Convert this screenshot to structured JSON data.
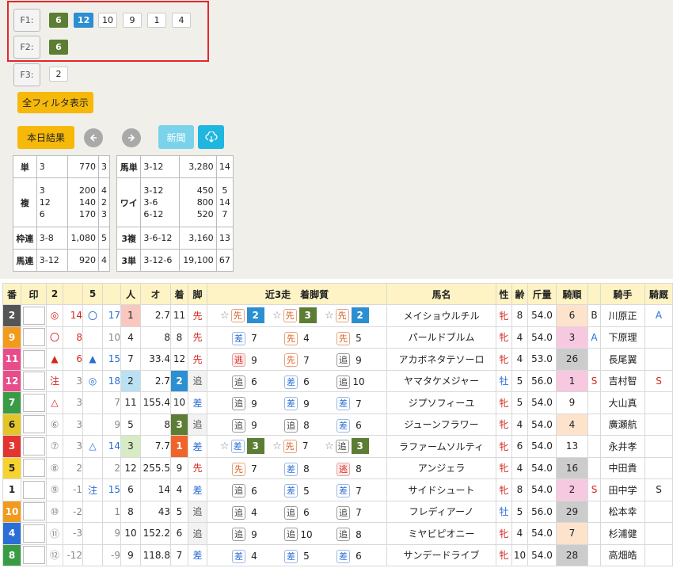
{
  "filters": {
    "f1": {
      "label": "F1:",
      "values": [
        "6",
        "12",
        "10",
        "9",
        "1",
        "4"
      ]
    },
    "f2": {
      "label": "F2:",
      "values": [
        "6"
      ]
    },
    "f3": {
      "label": "F3:",
      "values": [
        "2"
      ]
    },
    "show_all": "全フィルタ表示"
  },
  "controls": {
    "today_results": "本日結果",
    "prev_icon": "arrow-left-icon",
    "next_icon": "arrow-right-icon",
    "news": "新聞",
    "download_icon": "cloud-download-icon"
  },
  "payouts_left": [
    {
      "type": "単",
      "lines": [
        [
          "3",
          "770",
          "3"
        ]
      ]
    },
    {
      "type": "複",
      "lines": [
        [
          "3",
          "200",
          "4"
        ],
        [
          "12",
          "140",
          "2"
        ],
        [
          "6",
          "170",
          "3"
        ]
      ]
    },
    {
      "type": "枠連",
      "lines": [
        [
          "3-8",
          "1,080",
          "5"
        ]
      ]
    },
    {
      "type": "馬連",
      "lines": [
        [
          "3-12",
          "920",
          "4"
        ]
      ]
    }
  ],
  "payouts_right": [
    {
      "type": "馬単",
      "lines": [
        [
          "3-12",
          "3,280",
          "14"
        ]
      ]
    },
    {
      "type": "ワイ",
      "lines": [
        [
          "3-12",
          "450",
          "5"
        ],
        [
          "3-6",
          "800",
          "14"
        ],
        [
          "6-12",
          "520",
          "7"
        ]
      ]
    },
    {
      "type": "3複",
      "lines": [
        [
          "3-6-12",
          "3,160",
          "13"
        ]
      ]
    },
    {
      "type": "3単",
      "lines": [
        [
          "3-12-6",
          "19,100",
          "67"
        ]
      ]
    }
  ],
  "headers": [
    "番",
    "印",
    "2",
    "",
    "5",
    "",
    "人",
    "オ",
    "着",
    "脚",
    "近3走　着脚質",
    "馬名",
    "性",
    "齢",
    "斤量",
    "騎順",
    "",
    "騎手",
    "騎厩"
  ],
  "rows": [
    {
      "num": "2",
      "nc": "#555",
      "m1": "◎",
      "c1": "14",
      "m2": "〇",
      "c2": "17",
      "pop": "1",
      "popbg": "#f8c7bd",
      "odds": "2.7",
      "fin": "11",
      "finbg": "",
      "kyaku": "先",
      "kc": "red",
      "recent": [
        [
          "先",
          "2"
        ],
        [
          "先",
          "3"
        ],
        [
          "先",
          "2"
        ]
      ],
      "recentStar": [
        true,
        true,
        true
      ],
      "name": "メイショウルチル",
      "sex": "牝",
      "sexc": "red",
      "age": "8",
      "wt": "54.0",
      "jr": "6",
      "jrbg": "#fde3cc",
      "jb": "B",
      "jockey": "川原正",
      "jk": "A",
      "jkc": "blu"
    },
    {
      "num": "9",
      "nc": "#f29a1b",
      "m1": "〇",
      "c1": "8",
      "m2": "",
      "c2": "10",
      "pop": "4",
      "popbg": "",
      "odds": "8",
      "fin": "8",
      "finbg": "",
      "kyaku": "先",
      "kc": "red",
      "recent": [
        [
          "差",
          "7"
        ],
        [
          "先",
          "4"
        ],
        [
          "先",
          "5"
        ]
      ],
      "recentStar": [
        false,
        false,
        false
      ],
      "name": "パールドブルム",
      "sex": "牝",
      "sexc": "red",
      "age": "4",
      "wt": "54.0",
      "jr": "3",
      "jrbg": "#f7c9e0",
      "jb": "A",
      "jockey": "下原理",
      "jk": "",
      "jkc": ""
    },
    {
      "num": "11",
      "nc": "#e84d8a",
      "m1": "▲",
      "c1": "6",
      "m2": "▲",
      "c2": "15",
      "pop": "7",
      "popbg": "",
      "odds": "33.4",
      "fin": "12",
      "finbg": "",
      "kyaku": "先",
      "kc": "red",
      "recent": [
        [
          "逃",
          "9"
        ],
        [
          "先",
          "7"
        ],
        [
          "追",
          "9"
        ]
      ],
      "recentStar": [
        false,
        false,
        false
      ],
      "name": "アカボネタテソーロ",
      "sex": "牝",
      "sexc": "red",
      "age": "4",
      "wt": "53.0",
      "jr": "26",
      "jrbg": "#ccc",
      "jb": "",
      "jockey": "長尾翼",
      "jk": "",
      "jkc": ""
    },
    {
      "num": "12",
      "nc": "#e84d8a",
      "m1": "注",
      "c1": "3",
      "m2": "◎",
      "c2": "18",
      "pop": "2",
      "popbg": "#b9e1f3",
      "odds": "2.7",
      "fin": "2",
      "finbg": "#2b8fd1",
      "kyaku": "追",
      "kc": "gry",
      "recent": [
        [
          "追",
          "6"
        ],
        [
          "差",
          "6"
        ],
        [
          "追",
          "10"
        ]
      ],
      "recentStar": [
        false,
        false,
        false
      ],
      "name": "ヤマタケメジャー",
      "sex": "牡",
      "sexc": "blu",
      "age": "5",
      "wt": "56.0",
      "jr": "1",
      "jrbg": "#f7c9e0",
      "jb": "S",
      "jockey": "吉村智",
      "jk": "S",
      "jkc": "red"
    },
    {
      "num": "7",
      "nc": "#3a9b45",
      "m1": "△",
      "c1": "3",
      "m2": "",
      "c2": "7",
      "pop": "11",
      "popbg": "",
      "odds": "155.4",
      "fin": "10",
      "finbg": "",
      "kyaku": "差",
      "kc": "blu",
      "recent": [
        [
          "追",
          "9"
        ],
        [
          "差",
          "9"
        ],
        [
          "差",
          "7"
        ]
      ],
      "recentStar": [
        false,
        false,
        false
      ],
      "name": "ジプソフィーユ",
      "sex": "牝",
      "sexc": "red",
      "age": "5",
      "wt": "54.0",
      "jr": "9",
      "jrbg": "",
      "jb": "",
      "jockey": "大山真",
      "jk": "",
      "jkc": ""
    },
    {
      "num": "6",
      "nc": "#e3c52a",
      "m1": "⑥",
      "c1": "3",
      "m2": "",
      "c2": "9",
      "pop": "5",
      "popbg": "",
      "odds": "8",
      "fin": "3",
      "finbg": "#5b7d34",
      "kyaku": "追",
      "kc": "gry",
      "recent": [
        [
          "追",
          "9"
        ],
        [
          "追",
          "8"
        ],
        [
          "差",
          "6"
        ]
      ],
      "recentStar": [
        false,
        false,
        false
      ],
      "name": "ジューンフラワー",
      "sex": "牝",
      "sexc": "red",
      "age": "4",
      "wt": "54.0",
      "jr": "4",
      "jrbg": "#fde3cc",
      "jb": "",
      "jockey": "廣瀬航",
      "jk": "",
      "jkc": ""
    },
    {
      "num": "3",
      "nc": "#e3342f",
      "m1": "⑦",
      "c1": "3",
      "m2": "△",
      "c2": "14",
      "pop": "3",
      "popbg": "#d7ebc5",
      "odds": "7.7",
      "fin": "1",
      "finbg": "#f0642b",
      "kyaku": "差",
      "kc": "blu",
      "recent": [
        [
          "差",
          "3"
        ],
        [
          "先",
          "7"
        ],
        [
          "追",
          "3"
        ]
      ],
      "recentStar": [
        true,
        true,
        true
      ],
      "name": "ラファームソルティ",
      "sex": "牝",
      "sexc": "red",
      "age": "6",
      "wt": "54.0",
      "jr": "13",
      "jrbg": "",
      "jb": "",
      "jockey": "永井孝",
      "jk": "",
      "jkc": ""
    },
    {
      "num": "5",
      "nc": "#f6d32f",
      "m1": "⑧",
      "c1": "2",
      "m2": "",
      "c2": "2",
      "pop": "12",
      "popbg": "",
      "odds": "255.5",
      "fin": "9",
      "finbg": "",
      "kyaku": "先",
      "kc": "red",
      "recent": [
        [
          "先",
          "7"
        ],
        [
          "差",
          "8"
        ],
        [
          "逃",
          "8"
        ]
      ],
      "recentStar": [
        false,
        false,
        false
      ],
      "name": "アンジェラ",
      "sex": "牝",
      "sexc": "red",
      "age": "4",
      "wt": "54.0",
      "jr": "16",
      "jrbg": "#ccc",
      "jb": "",
      "jockey": "中田貴",
      "jk": "",
      "jkc": ""
    },
    {
      "num": "1",
      "nc": "#fff",
      "m1": "⑨",
      "c1": "-1",
      "m2": "注",
      "c2": "15",
      "pop": "6",
      "popbg": "",
      "odds": "14",
      "fin": "4",
      "finbg": "",
      "kyaku": "差",
      "kc": "blu",
      "recent": [
        [
          "追",
          "6"
        ],
        [
          "差",
          "5"
        ],
        [
          "差",
          "7"
        ]
      ],
      "recentStar": [
        false,
        false,
        false
      ],
      "name": "サイドシュート",
      "sex": "牝",
      "sexc": "red",
      "age": "8",
      "wt": "54.0",
      "jr": "2",
      "jrbg": "#f7c9e0",
      "jb": "S",
      "jockey": "田中学",
      "jk": "S",
      "jkc": ""
    },
    {
      "num": "10",
      "nc": "#f29a1b",
      "m1": "⑩",
      "c1": "-2",
      "m2": "",
      "c2": "1",
      "pop": "8",
      "popbg": "",
      "odds": "43",
      "fin": "5",
      "finbg": "",
      "kyaku": "追",
      "kc": "gry",
      "recent": [
        [
          "追",
          "4"
        ],
        [
          "追",
          "6"
        ],
        [
          "追",
          "7"
        ]
      ],
      "recentStar": [
        false,
        false,
        false
      ],
      "name": "フレディアーノ",
      "sex": "牡",
      "sexc": "blu",
      "age": "5",
      "wt": "56.0",
      "jr": "29",
      "jrbg": "#ccc",
      "jb": "",
      "jockey": "松本幸",
      "jk": "",
      "jkc": ""
    },
    {
      "num": "4",
      "nc": "#2b6ed6",
      "m1": "⑪",
      "c1": "-3",
      "m2": "",
      "c2": "9",
      "pop": "10",
      "popbg": "",
      "odds": "152.2",
      "fin": "6",
      "finbg": "",
      "kyaku": "追",
      "kc": "gry",
      "recent": [
        [
          "追",
          "9"
        ],
        [
          "追",
          "10"
        ],
        [
          "追",
          "8"
        ]
      ],
      "recentStar": [
        false,
        false,
        false
      ],
      "name": "ミヤビピオニー",
      "sex": "牝",
      "sexc": "red",
      "age": "4",
      "wt": "54.0",
      "jr": "7",
      "jrbg": "#fde3cc",
      "jb": "",
      "jockey": "杉浦健",
      "jk": "",
      "jkc": ""
    },
    {
      "num": "8",
      "nc": "#3a9b45",
      "m1": "⑫",
      "c1": "-12",
      "m2": "",
      "c2": "-9",
      "pop": "9",
      "popbg": "",
      "odds": "118.8",
      "fin": "7",
      "finbg": "",
      "kyaku": "差",
      "kc": "blu",
      "recent": [
        [
          "差",
          "4"
        ],
        [
          "差",
          "5"
        ],
        [
          "差",
          "6"
        ]
      ],
      "recentStar": [
        false,
        false,
        false
      ],
      "name": "サンデードライブ",
      "sex": "牝",
      "sexc": "red",
      "age": "10",
      "wt": "54.0",
      "jr": "28",
      "jrbg": "#ccc",
      "jb": "",
      "jockey": "高畑皓",
      "jk": "",
      "jkc": ""
    }
  ]
}
